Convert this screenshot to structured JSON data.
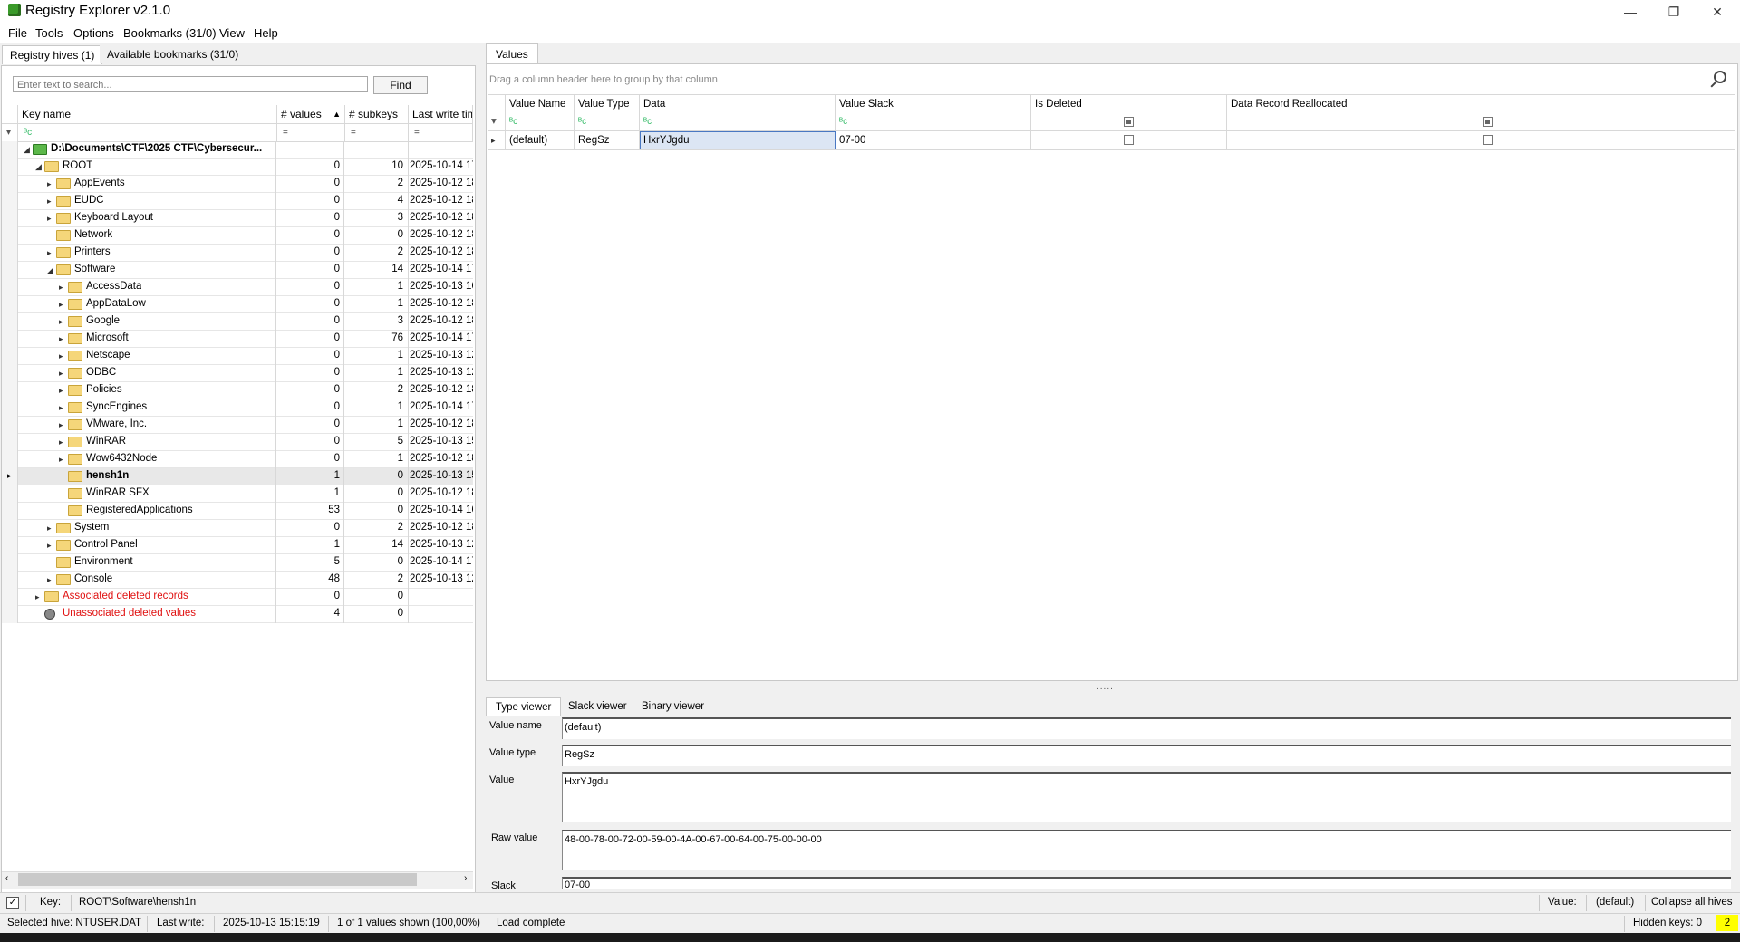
{
  "window": {
    "title": "Registry Explorer v2.1.0",
    "minimize": "—",
    "maximize": "❐",
    "close": "✕"
  },
  "menu": [
    "File",
    "Tools",
    "Options",
    "Bookmarks (31/0)",
    "View",
    "Help"
  ],
  "left": {
    "tabs": [
      "Registry hives (1)",
      "Available bookmarks (31/0)"
    ],
    "search_placeholder": "Enter text to search...",
    "find_label": "Find",
    "columns": [
      "Key name",
      "# values",
      "# subkeys",
      "Last write time"
    ],
    "filter_eq": "=",
    "filter_icon": "ᴮᴄ",
    "rows": [
      {
        "name": "D:\\Documents\\CTF\\2025 CTF\\Cybersecur...",
        "values": "",
        "subkeys": "",
        "date": "",
        "level": 0,
        "exp": "◢",
        "icon": "hive",
        "bold": true
      },
      {
        "name": "ROOT",
        "values": "0",
        "subkeys": "10",
        "date": "2025-10-14 17",
        "level": 1,
        "exp": "◢",
        "icon": "folder"
      },
      {
        "name": "AppEvents",
        "values": "0",
        "subkeys": "2",
        "date": "2025-10-12 18",
        "level": 2,
        "exp": "▸",
        "icon": "folder"
      },
      {
        "name": "EUDC",
        "values": "0",
        "subkeys": "4",
        "date": "2025-10-12 18",
        "level": 2,
        "exp": "▸",
        "icon": "folder"
      },
      {
        "name": "Keyboard Layout",
        "values": "0",
        "subkeys": "3",
        "date": "2025-10-12 18",
        "level": 2,
        "exp": "▸",
        "icon": "folder"
      },
      {
        "name": "Network",
        "values": "0",
        "subkeys": "0",
        "date": "2025-10-12 18",
        "level": 2,
        "exp": "",
        "icon": "folder"
      },
      {
        "name": "Printers",
        "values": "0",
        "subkeys": "2",
        "date": "2025-10-12 18",
        "level": 2,
        "exp": "▸",
        "icon": "folder"
      },
      {
        "name": "Software",
        "values": "0",
        "subkeys": "14",
        "date": "2025-10-14 17",
        "level": 2,
        "exp": "◢",
        "icon": "folder"
      },
      {
        "name": "AccessData",
        "values": "0",
        "subkeys": "1",
        "date": "2025-10-13 16",
        "level": 3,
        "exp": "▸",
        "icon": "folder"
      },
      {
        "name": "AppDataLow",
        "values": "0",
        "subkeys": "1",
        "date": "2025-10-12 18",
        "level": 3,
        "exp": "▸",
        "icon": "folder"
      },
      {
        "name": "Google",
        "values": "0",
        "subkeys": "3",
        "date": "2025-10-12 18",
        "level": 3,
        "exp": "▸",
        "icon": "folder"
      },
      {
        "name": "Microsoft",
        "values": "0",
        "subkeys": "76",
        "date": "2025-10-14 17",
        "level": 3,
        "exp": "▸",
        "icon": "folder"
      },
      {
        "name": "Netscape",
        "values": "0",
        "subkeys": "1",
        "date": "2025-10-13 12",
        "level": 3,
        "exp": "▸",
        "icon": "folder"
      },
      {
        "name": "ODBC",
        "values": "0",
        "subkeys": "1",
        "date": "2025-10-13 12",
        "level": 3,
        "exp": "▸",
        "icon": "folder"
      },
      {
        "name": "Policies",
        "values": "0",
        "subkeys": "2",
        "date": "2025-10-12 18",
        "level": 3,
        "exp": "▸",
        "icon": "folder"
      },
      {
        "name": "SyncEngines",
        "values": "0",
        "subkeys": "1",
        "date": "2025-10-14 17",
        "level": 3,
        "exp": "▸",
        "icon": "folder"
      },
      {
        "name": "VMware, Inc.",
        "values": "0",
        "subkeys": "1",
        "date": "2025-10-12 18",
        "level": 3,
        "exp": "▸",
        "icon": "folder"
      },
      {
        "name": "WinRAR",
        "values": "0",
        "subkeys": "5",
        "date": "2025-10-13 15",
        "level": 3,
        "exp": "▸",
        "icon": "folder"
      },
      {
        "name": "Wow6432Node",
        "values": "0",
        "subkeys": "1",
        "date": "2025-10-12 18",
        "level": 3,
        "exp": "▸",
        "icon": "folder"
      },
      {
        "name": "hensh1n",
        "values": "1",
        "subkeys": "0",
        "date": "2025-10-13 15",
        "level": 3,
        "exp": "",
        "icon": "folder",
        "bold": true,
        "selected": true
      },
      {
        "name": "WinRAR SFX",
        "values": "1",
        "subkeys": "0",
        "date": "2025-10-12 18",
        "level": 3,
        "exp": "",
        "icon": "folder"
      },
      {
        "name": "RegisteredApplications",
        "values": "53",
        "subkeys": "0",
        "date": "2025-10-14 16",
        "level": 3,
        "exp": "",
        "icon": "folder"
      },
      {
        "name": "System",
        "values": "0",
        "subkeys": "2",
        "date": "2025-10-12 18",
        "level": 2,
        "exp": "▸",
        "icon": "folder"
      },
      {
        "name": "Control Panel",
        "values": "1",
        "subkeys": "14",
        "date": "2025-10-13 12",
        "level": 2,
        "exp": "▸",
        "icon": "folder"
      },
      {
        "name": "Environment",
        "values": "5",
        "subkeys": "0",
        "date": "2025-10-14 17",
        "level": 2,
        "exp": "",
        "icon": "folder"
      },
      {
        "name": "Console",
        "values": "48",
        "subkeys": "2",
        "date": "2025-10-13 12",
        "level": 2,
        "exp": "▸",
        "icon": "folder"
      },
      {
        "name": "Associated deleted records",
        "values": "0",
        "subkeys": "0",
        "date": "",
        "level": 1,
        "exp": "▸",
        "icon": "deleted-folder",
        "red": true
      },
      {
        "name": "Unassociated deleted values",
        "values": "4",
        "subkeys": "0",
        "date": "",
        "level": 1,
        "exp": "",
        "icon": "deleted-values",
        "red": true
      }
    ]
  },
  "values_panel": {
    "tab": "Values",
    "group_hint": "Drag a column header here to group by that column",
    "columns": [
      "Value Name",
      "Value Type",
      "Data",
      "Value Slack",
      "Is Deleted",
      "Data Record Reallocated"
    ],
    "row": {
      "name": "(default)",
      "type": "RegSz",
      "data": "HxrYJgdu",
      "slack": "07-00",
      "is_deleted": false,
      "reallocated": false
    }
  },
  "viewer": {
    "tabs": [
      "Type viewer",
      "Slack viewer",
      "Binary viewer"
    ],
    "splitter": ".....",
    "labels": {
      "value_name": "Value name",
      "value_type": "Value type",
      "value": "Value",
      "raw_value": "Raw value",
      "slack": "Slack"
    },
    "value_name": "(default)",
    "value_type": "RegSz",
    "value": "HxrYJgdu",
    "raw_value": "48-00-78-00-72-00-59-00-4A-00-67-00-64-00-75-00-00-00",
    "slack": "07-00"
  },
  "status1": {
    "key_label": "Key:",
    "key_path": "ROOT\\Software\\hensh1n",
    "value_label": "Value:",
    "value": "(default)",
    "collapse": "Collapse all hives"
  },
  "status2": {
    "hive": "Selected hive: NTUSER.DAT",
    "last_write_label": "Last write:",
    "last_write": "2025-10-13 15:15:19",
    "shown": "1 of 1 values shown (100,00%)",
    "load": "Load complete",
    "hidden_keys": "Hidden keys: 0",
    "badge": "2"
  }
}
